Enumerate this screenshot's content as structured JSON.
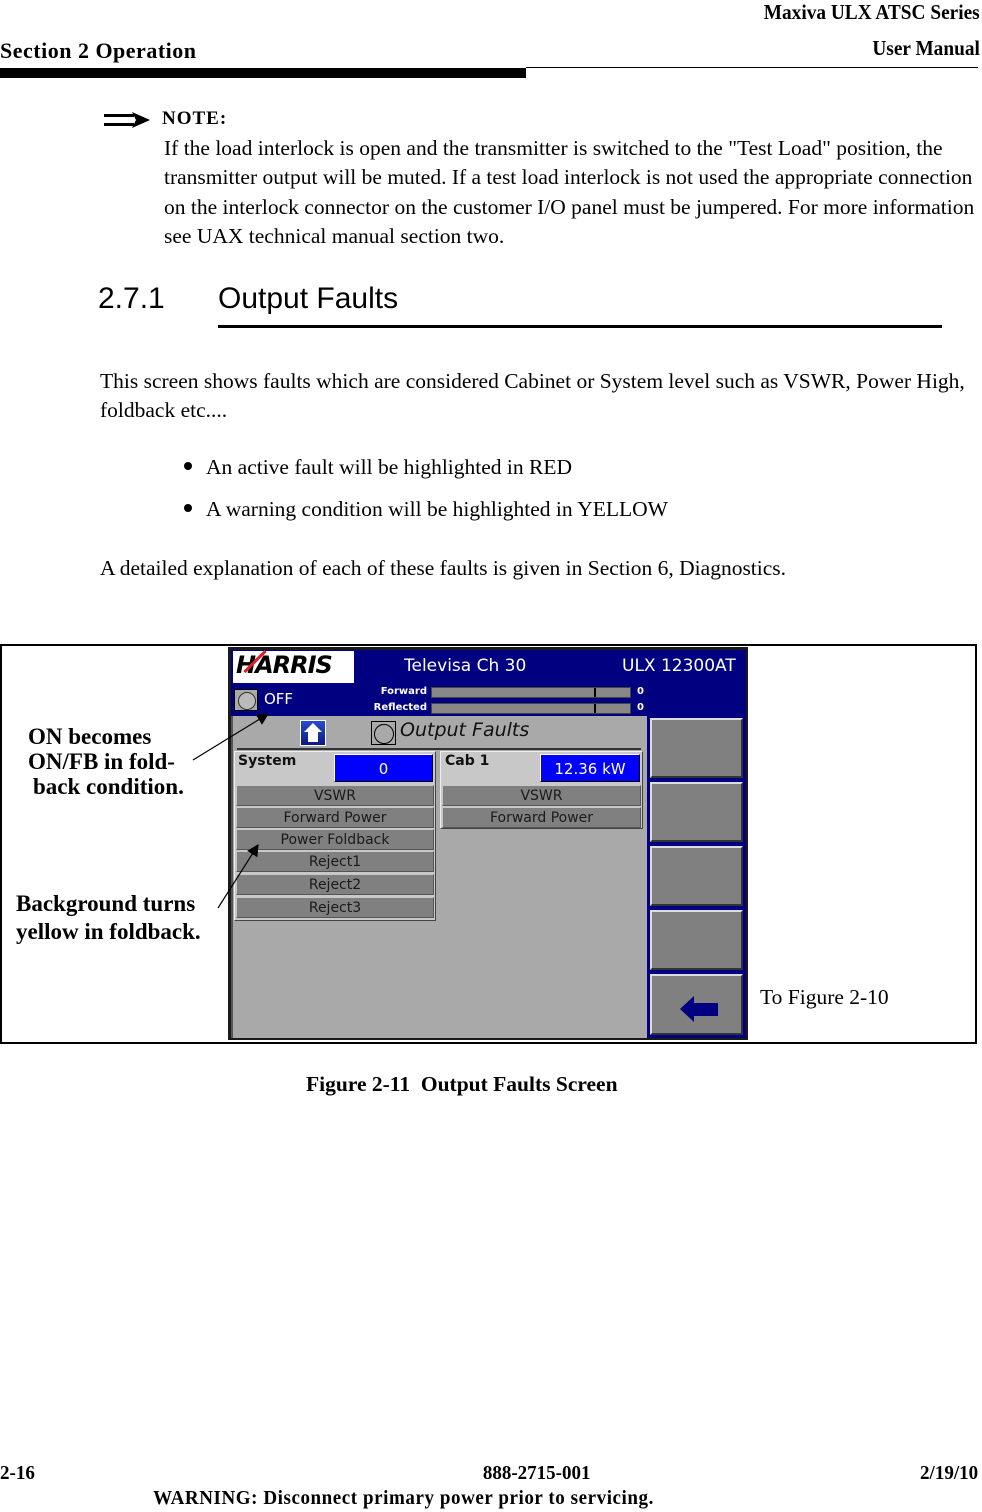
{
  "header": {
    "series": "Maxiva ULX ATSC Series",
    "manual": "User Manual",
    "section": "Section 2 Operation"
  },
  "note": {
    "icon": "note-arrow-icon",
    "label": "NOTE:",
    "text": "If the load interlock is open and the transmitter is switched to the \"Test Load\" position, the transmitter output will be muted. If a test load interlock is not used the appropriate connection on the interlock connector on the customer I/O panel must be jumpered. For more information see UAX technical manual section two."
  },
  "section": {
    "number": "2.7.1",
    "title": "Output Faults"
  },
  "body": {
    "intro": "This screen shows faults which are considered Cabinet or System level such as VSWR, Power High, foldback etc....",
    "bullets": [
      "An active fault will be highlighted in RED",
      "A warning condition will be highlighted in YELLOW"
    ],
    "detail": "A detailed explanation of each of these faults is given in Section 6, Diagnostics."
  },
  "figure": {
    "screen": {
      "logo": "HARRIS",
      "station": "Televisa Ch 30",
      "model": "ULX 12300AT",
      "status": "OFF",
      "meters": [
        {
          "label": "Forward",
          "value": "0"
        },
        {
          "label": "Reflected",
          "value": "0"
        }
      ],
      "page_title": "Output Faults",
      "panels": [
        {
          "name": "System",
          "value": "0",
          "faults": [
            "VSWR",
            "Forward Power",
            "Power Foldback",
            "Reject1",
            "Reject2",
            "Reject3"
          ]
        },
        {
          "name": "Cab 1",
          "value": "12.36 kW",
          "faults": [
            "VSWR",
            "Forward Power"
          ]
        }
      ],
      "side_buttons": [
        "",
        "",
        "",
        "",
        "back-arrow-icon"
      ]
    },
    "callouts": {
      "on_fb_line1": "ON becomes",
      "on_fb_line2": "ON/FB in fold-",
      "on_fb_line3": "back condition.",
      "bg_line1": "Background turns",
      "bg_line2": "yellow in foldback."
    },
    "to_figure": "To Figure 2-10",
    "caption": "Figure 2-11  Output Faults Screen"
  },
  "footer": {
    "page": "2-16",
    "doc_number": "888-2715-001",
    "date": "2/19/10",
    "warning": "WARNING: Disconnect primary power prior to servicing."
  },
  "colors": {
    "screen_blue": "#000080",
    "value_box_blue": "#0000ff",
    "panel_gray": "#a9a9a9",
    "fault_row_gray": "#808080"
  }
}
